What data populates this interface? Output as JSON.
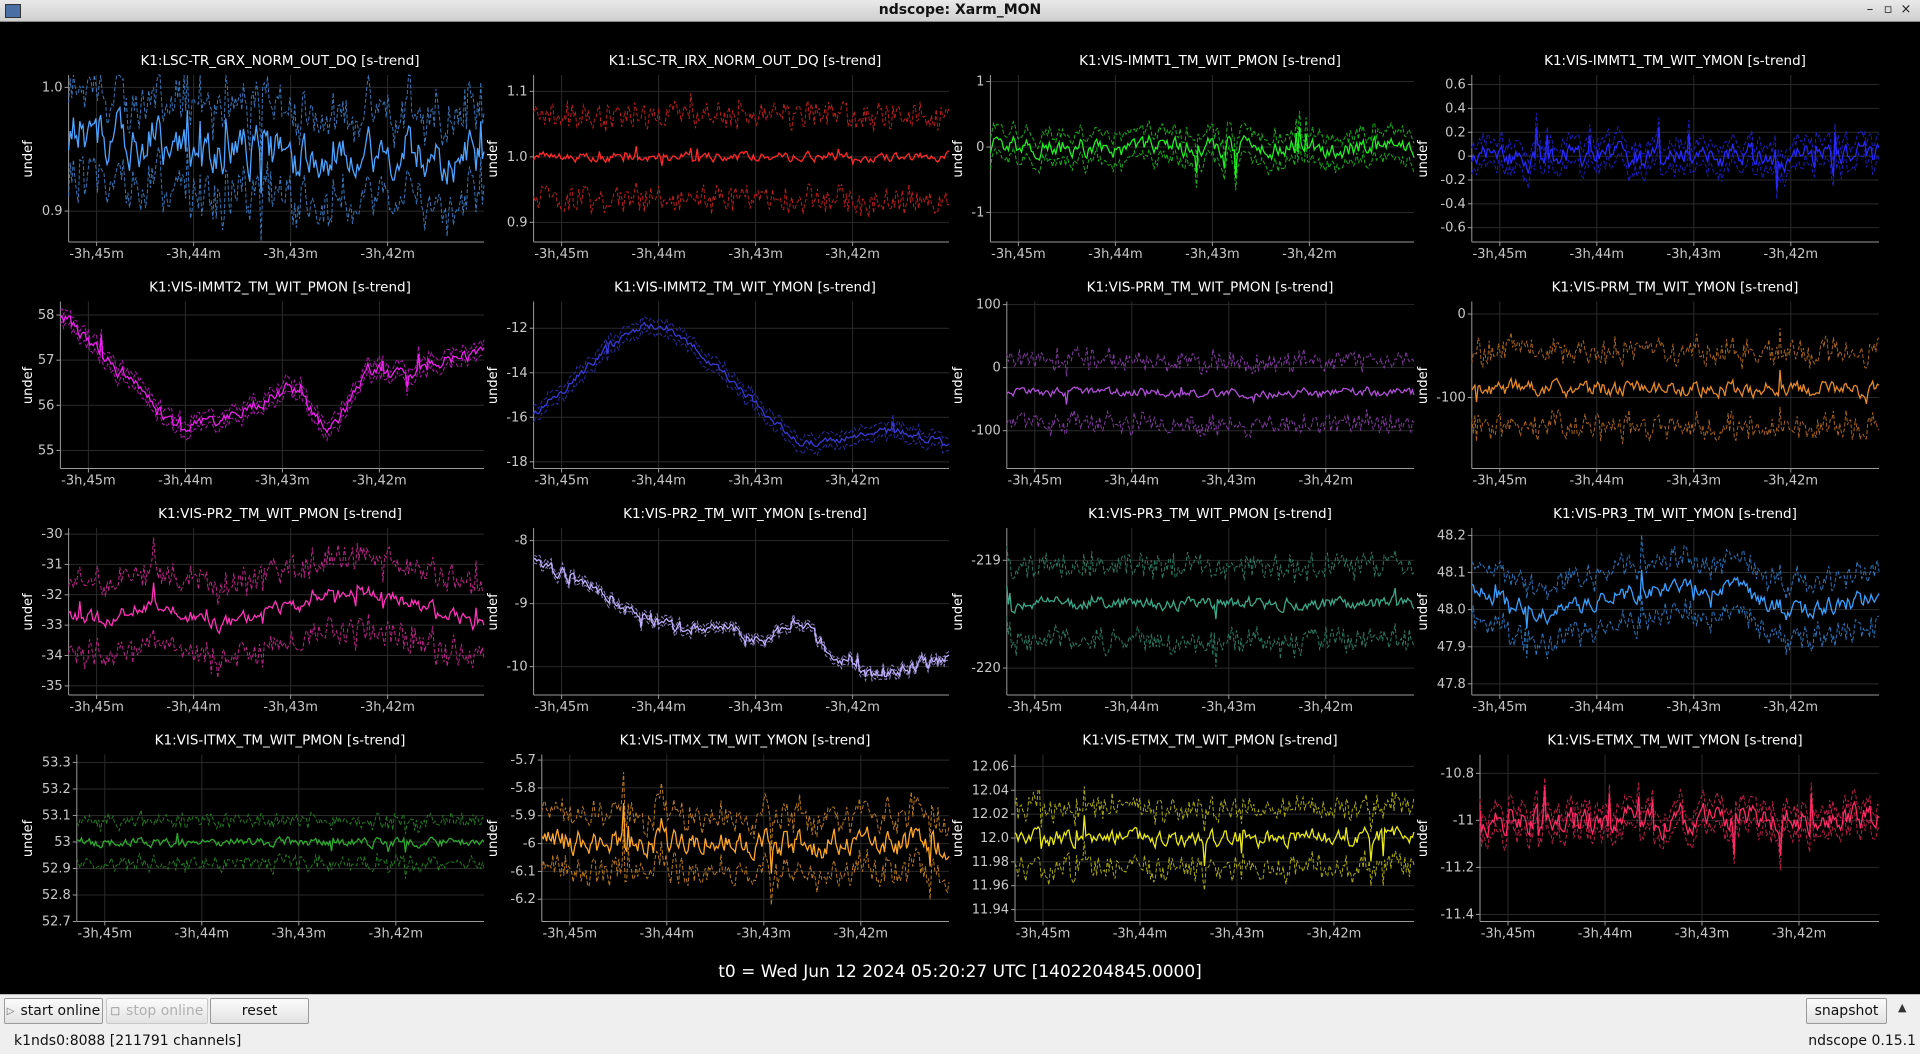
{
  "window": {
    "title": "ndscope: Xarm_MON",
    "controls": [
      "–",
      "▫",
      "×"
    ]
  },
  "x_ticks": [
    "-3h,45m",
    "-3h,44m",
    "-3h,43m",
    "-3h,42m"
  ],
  "y_axis_label": "undef",
  "plots": [
    {
      "title": "K1:LSC-TR_GRX_NORM_OUT_DQ [s-trend]",
      "color": "#4da3ff",
      "yticks": [
        "1.0",
        "0.9"
      ],
      "ylim": [
        0.875,
        1.01
      ],
      "mid": 0.95,
      "band": 0.035,
      "noise": 0.016,
      "trend": [
        0.965,
        0.96,
        0.955,
        0.95,
        0.948,
        0.95,
        0.945,
        0.95,
        0.948,
        0.95,
        0.945,
        0.94
      ]
    },
    {
      "title": "K1:LSC-TR_IRX_NORM_OUT_DQ [s-trend]",
      "color": "#ff2a2a",
      "yticks": [
        "1.1",
        "1.0",
        "0.9"
      ],
      "ylim": [
        0.87,
        1.125
      ],
      "mid": 1.0,
      "band": 0.065,
      "noise": 0.006,
      "trend": [
        1.0,
        1.0,
        1.0,
        1.0,
        1.0,
        1.0,
        1.0,
        1.0,
        1.0,
        1.0,
        1.0,
        1.0
      ]
    },
    {
      "title": "K1:VIS-IMMT1_TM_WIT_PMON [s-trend]",
      "color": "#22ee22",
      "yticks": [
        "1",
        "0",
        "-1"
      ],
      "ylim": [
        -1.45,
        1.1
      ],
      "mid": 0.0,
      "band": 0.2,
      "noise": 0.12,
      "trend": [
        0,
        0,
        0,
        0,
        0,
        0,
        0,
        0,
        0,
        0,
        0,
        0
      ]
    },
    {
      "title": "K1:VIS-IMMT1_TM_WIT_YMON [s-trend]",
      "color": "#2828ff",
      "yticks": [
        "0.6",
        "0.4",
        "0.2",
        "0",
        "-0.2",
        "-0.4",
        "-0.6"
      ],
      "ylim": [
        -0.72,
        0.68
      ],
      "mid": 0.0,
      "band": 0.1,
      "noise": 0.08,
      "trend": [
        0,
        0,
        0,
        0,
        0,
        0,
        0,
        0,
        0,
        0,
        0,
        0
      ]
    },
    {
      "title": "K1:VIS-IMMT2_TM_WIT_PMON [s-trend]",
      "color": "#ee22ee",
      "yticks": [
        "58",
        "57",
        "56",
        "55"
      ],
      "ylim": [
        54.6,
        58.3
      ],
      "mid": 0,
      "band": 0.15,
      "noise": 0.12,
      "trend": [
        58.0,
        57.2,
        56.4,
        55.5,
        55.7,
        56.0,
        56.4,
        55.4,
        56.8,
        56.6,
        57.0,
        57.2
      ]
    },
    {
      "title": "K1:VIS-IMMT2_TM_WIT_YMON [s-trend]",
      "color": "#3a3ad8",
      "yticks": [
        "-12",
        "-14",
        "-16",
        "-18"
      ],
      "ylim": [
        -18.3,
        -10.8
      ],
      "mid": 0,
      "band": 0.3,
      "noise": 0.15,
      "trend": [
        -15.8,
        -14.5,
        -12.8,
        -11.8,
        -12.5,
        -14.0,
        -15.6,
        -17.2,
        -17.0,
        -16.6,
        -16.7,
        -17.3
      ]
    },
    {
      "title": "K1:VIS-PRM_TM_WIT_PMON [s-trend]",
      "color": "#b04fd8",
      "yticks": [
        "100",
        "0",
        "-100"
      ],
      "ylim": [
        -160,
        105
      ],
      "mid": -40,
      "band": 50,
      "noise": 6,
      "trend": [
        -40,
        -40,
        -40,
        -40,
        -40,
        -40,
        -40,
        -40,
        -40,
        -40,
        -40,
        -40
      ]
    },
    {
      "title": "K1:VIS-PRM_TM_WIT_YMON [s-trend]",
      "color": "#e8882a",
      "yticks": [
        "0",
        "-100"
      ],
      "ylim": [
        -185,
        15
      ],
      "mid": -90,
      "band": 45,
      "noise": 8,
      "trend": [
        -90,
        -90,
        -90,
        -90,
        -90,
        -90,
        -90,
        -90,
        -90,
        -90,
        -90,
        -90
      ]
    },
    {
      "title": "K1:VIS-PR2_TM_WIT_PMON [s-trend]",
      "color": "#ff33bb",
      "yticks": [
        "-30",
        "-31",
        "-32",
        "-33",
        "-34",
        "-35"
      ],
      "ylim": [
        -35.3,
        -29.8
      ],
      "mid": 0,
      "band": 1.2,
      "noise": 0.2,
      "trend": [
        -32.6,
        -32.9,
        -32.3,
        -32.6,
        -33.0,
        -32.6,
        -32.4,
        -32.0,
        -31.9,
        -32.2,
        -32.6,
        -33.0
      ]
    },
    {
      "title": "K1:VIS-PR2_TM_WIT_YMON [s-trend]",
      "color": "#c0b0ff",
      "yticks": [
        "-8",
        "-9",
        "-10"
      ],
      "ylim": [
        -10.45,
        -7.8
      ],
      "mid": 0,
      "band": 0.06,
      "noise": 0.08,
      "trend": [
        -8.3,
        -8.6,
        -8.9,
        -9.2,
        -9.4,
        -9.3,
        -9.6,
        -9.3,
        -9.8,
        -10.2,
        -10.0,
        -9.9
      ]
    },
    {
      "title": "K1:VIS-PR3_TM_WIT_PMON [s-trend]",
      "color": "#3aa888",
      "yticks": [
        "-219",
        "-220"
      ],
      "ylim": [
        -220.25,
        -218.7
      ],
      "mid": -219.4,
      "band": 0.35,
      "noise": 0.05,
      "trend": [
        -219.4,
        -219.4,
        -219.4,
        -219.4,
        -219.4,
        -219.4,
        -219.4,
        -219.4,
        -219.4,
        -219.4,
        -219.4,
        -219.4
      ]
    },
    {
      "title": "K1:VIS-PR3_TM_WIT_YMON [s-trend]",
      "color": "#3aa0ff",
      "yticks": [
        "48.2",
        "48.1",
        "48.0",
        "47.9",
        "47.8"
      ],
      "ylim": [
        47.77,
        48.22
      ],
      "mid": 0,
      "band": 0.075,
      "noise": 0.02,
      "trend": [
        48.06,
        48.02,
        47.99,
        48.01,
        48.04,
        48.05,
        48.07,
        48.06,
        48.02,
        48.0,
        48.02,
        48.03
      ]
    },
    {
      "title": "K1:VIS-ITMX_TM_WIT_PMON [s-trend]",
      "color": "#2ea82e",
      "yticks": [
        "53.3",
        "53.2",
        "53.1",
        "53",
        "52.9",
        "52.8",
        "52.7"
      ],
      "ylim": [
        52.7,
        53.33
      ],
      "mid": 53.0,
      "band": 0.08,
      "noise": 0.015,
      "trend": [
        53,
        53,
        53,
        53,
        53,
        53,
        53,
        53,
        53,
        53,
        53,
        53
      ]
    },
    {
      "title": "K1:VIS-ITMX_TM_WIT_YMON [s-trend]",
      "color": "#ffa62a",
      "yticks": [
        "-5.7",
        "-5.8",
        "-5.9",
        "-6",
        "-6.1",
        "-6.2"
      ],
      "ylim": [
        -6.28,
        -5.68
      ],
      "mid": -6.0,
      "band": 0.1,
      "noise": 0.04,
      "trend": [
        -6,
        -6,
        -6,
        -6,
        -6,
        -6,
        -6,
        -6,
        -6,
        -6,
        -6,
        -6
      ]
    },
    {
      "title": "K1:VIS-ETMX_TM_WIT_PMON [s-trend]",
      "color": "#e8e81a",
      "yticks": [
        "12.06",
        "12.04",
        "12.02",
        "12.0",
        "11.98",
        "11.96",
        "11.94"
      ],
      "ylim": [
        11.93,
        12.07
      ],
      "mid": 12.0,
      "band": 0.025,
      "noise": 0.006,
      "trend": [
        12,
        12,
        12,
        12,
        12,
        12,
        12,
        12,
        12,
        12,
        12,
        12
      ]
    },
    {
      "title": "K1:VIS-ETMX_TM_WIT_YMON [s-trend]",
      "color": "#ff2a66",
      "yticks": [
        "-10.8",
        "-11",
        "-11.2",
        "-11.4"
      ],
      "ylim": [
        -11.43,
        -10.72
      ],
      "mid": -11.0,
      "band": 0.05,
      "noise": 0.05,
      "trend": [
        -11,
        -11,
        -11,
        -11,
        -11,
        -11,
        -11,
        -11,
        -11,
        -11,
        -11,
        -11
      ]
    }
  ],
  "t0_text": "t0 = Wed Jun 12 2024 05:20:27 UTC [1402204845.0000]",
  "toolbar": {
    "start_online": "start online",
    "stop_online": "stop online",
    "reset": "reset",
    "snapshot": "snapshot"
  },
  "status": {
    "server": "k1nds0:8088  [211791 channels]",
    "version": "ndscope 0.15.1"
  }
}
